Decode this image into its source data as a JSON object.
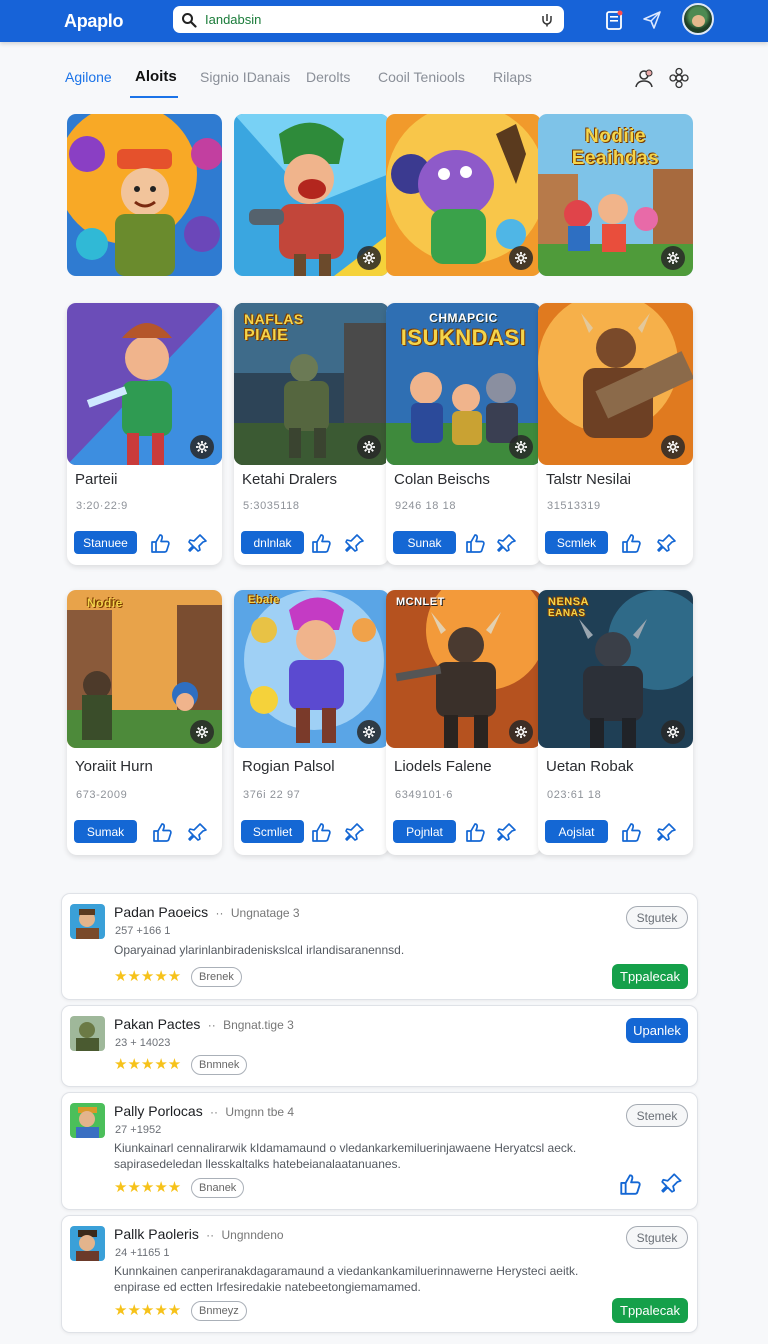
{
  "header": {
    "app_title": "Apaplo",
    "search_value": "Iandabsin",
    "icons": [
      "search-icon",
      "mic-icon",
      "clipboard-icon",
      "send-icon",
      "avatar"
    ]
  },
  "tabs": {
    "items": [
      "Agilone",
      "Aloits",
      "Signio IDanais",
      "Derolts",
      "Cooil Teniools",
      "Rilaps"
    ],
    "active_index": 1,
    "actions": [
      "user-search-icon",
      "settings-icon"
    ]
  },
  "grid": {
    "art_row": [
      {
        "badge": "gear-icon"
      },
      {
        "badge": "gear-icon"
      },
      {
        "badge": "gear-icon"
      },
      {
        "badge": "gear-icon",
        "art_text": [
          "Nodiie",
          "Eeaihdas"
        ]
      }
    ],
    "cards": [
      {
        "name": "Parteii",
        "number": "3:20·22:9",
        "button": "Stanuee",
        "art_text": []
      },
      {
        "name": "Ketahi Dralers",
        "number": "5:3035118",
        "button": "dnlnlak",
        "art_text": [
          "NAFLAS",
          "PIAIE"
        ]
      },
      {
        "name": "Colan Beischs",
        "number": "9246 18 18",
        "button": "Sunak",
        "art_text": [
          "CHMAPCIC",
          "ISUKNDASI"
        ]
      },
      {
        "name": "Talstr Nesilai",
        "number": "31513319",
        "button": "Scmlek",
        "art_text": []
      },
      {
        "name": "Yoraiit Hurn",
        "number": "673-2009",
        "button": "Sumak",
        "art_text": [
          "Nodie"
        ]
      },
      {
        "name": "Rogian Palsol",
        "number": "376i 22 97",
        "button": "Scmliet",
        "art_text": [
          "Ebaie"
        ]
      },
      {
        "name": "Liodels Falene",
        "number": "6349101·6",
        "button": "Pojnlat",
        "art_text": [
          "MCNLET"
        ]
      },
      {
        "name": "Uetan Robak",
        "number": "023:61 18",
        "button": "Aojslat",
        "art_text": [
          "NENSA",
          "EANAS"
        ]
      }
    ]
  },
  "list": [
    {
      "title": "Padan Paoeics",
      "sub": "Ungnatage 3",
      "number": "257 +166 1",
      "desc": "Oparyainad ylarinlanbiradeniskslcal irlandisaranennsd.",
      "stars": "★★★★★",
      "tag": "Brenek",
      "button": "Stgutek",
      "action": "Tppalecak"
    },
    {
      "title": "Pakan Pactes",
      "sub": "Bngnat.tige 3",
      "number": "23 + 14023",
      "desc": "",
      "stars": "★★★★★",
      "tag": "Bnmnek",
      "button": "",
      "action": "Upanlek"
    },
    {
      "title": "Pally Porlocas",
      "sub": "Umgnn tbe 4",
      "number": "27 +1952",
      "desc": "Kiunkainarl cennalirarwik kIdamamaund o vledankarkemiluerinjawaene Heryatcsl aeck. sapirasedeledan llesskaltalks hatebeianalaatanuanes.",
      "stars": "★★★★★",
      "tag": "Bnanek",
      "button": "Stemek",
      "action": ""
    },
    {
      "title": "Pallk Paoleris",
      "sub": "Ungnndeno",
      "number": "24 +1165 1",
      "desc": "Kunnkainen canperiranakdagaramaund a viedankankamiluerinnawerne Herysteci aeitk. enpirase ed ectten Irfesiredakie natebeetongiemamamed.",
      "stars": "★★★★★",
      "tag": "Bnmeyz",
      "button": "Stgutek",
      "action": "Tppalecak"
    }
  ],
  "colors": {
    "primary": "#1467d4",
    "topbar": "#1763d8",
    "green": "#15a04a",
    "star": "#f6c21a"
  }
}
